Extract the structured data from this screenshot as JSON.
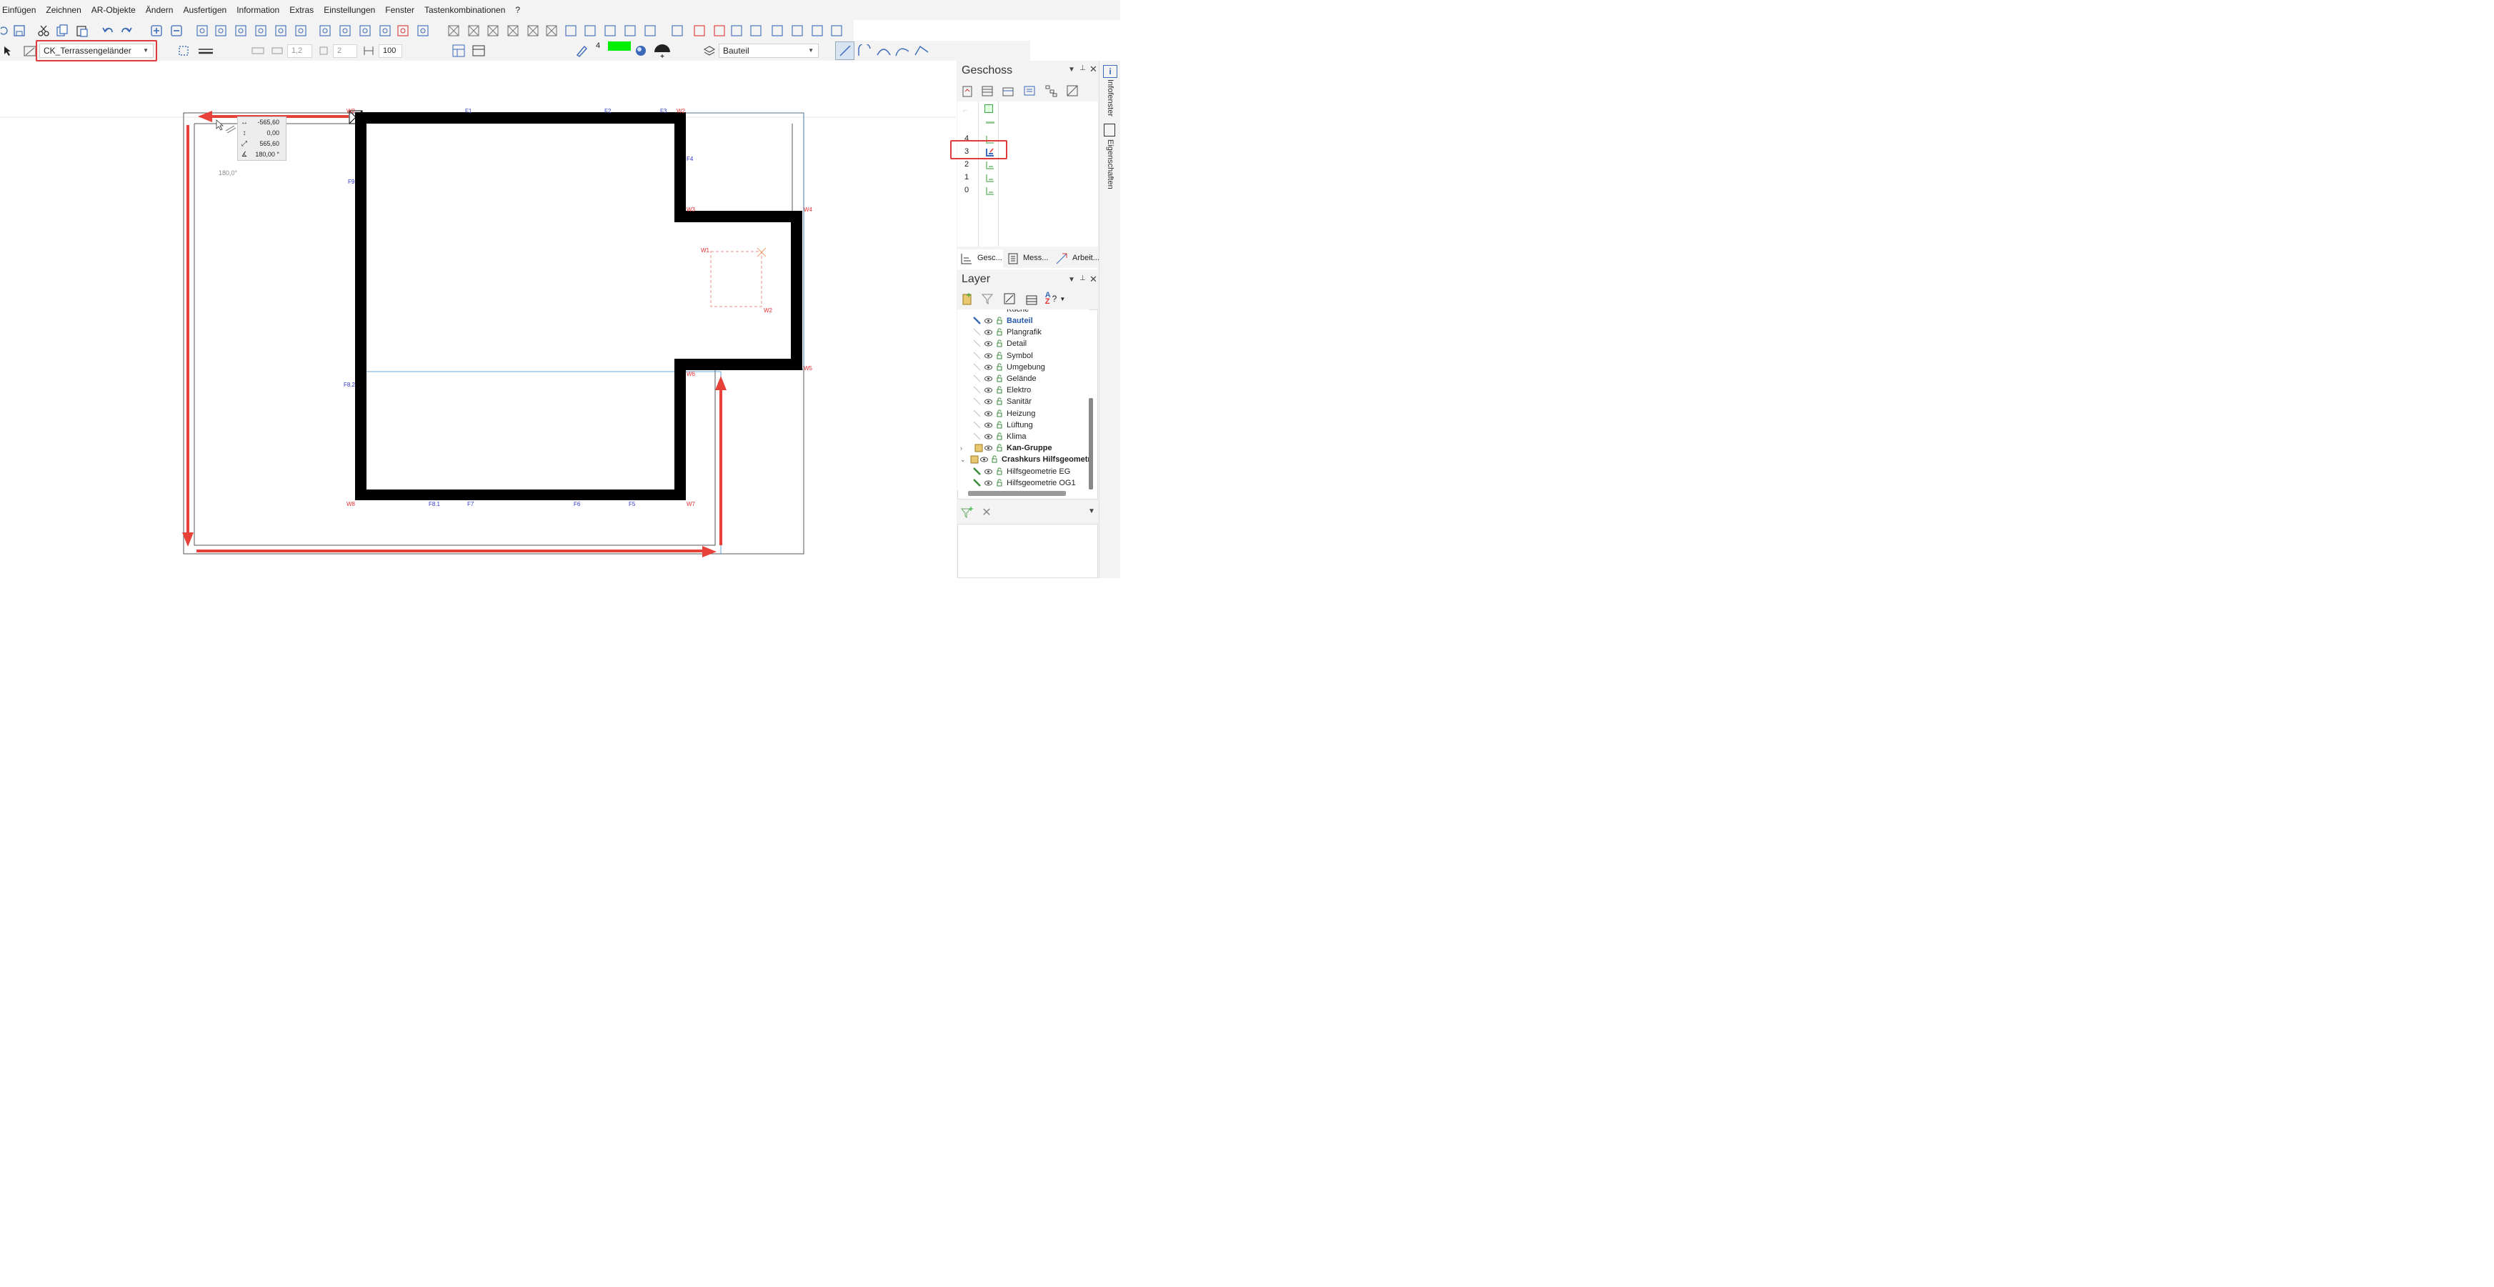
{
  "menu": [
    "Einfügen",
    "Zeichnen",
    "AR-Objekte",
    "Ändern",
    "Ausfertigen",
    "Information",
    "Extras",
    "Einstellungen",
    "Fenster",
    "Tastenkombinationen",
    "?"
  ],
  "toolbar2": {
    "object_type": "CK_Terrassengeländer",
    "field_1": "1,2",
    "field_2": "2",
    "field_3": "100",
    "pen_number": "4",
    "pen_color": "#00ee00",
    "layer_combo": "Bauteil"
  },
  "canvas": {
    "angle_tip": "180,0°",
    "coords": {
      "dx": "-565,60",
      "dy": "0,00",
      "length": "565,60",
      "angle": "180,00 °"
    },
    "point_labels": [
      {
        "text": "W2",
        "color": "red"
      },
      {
        "text": "F1",
        "color": "blue"
      },
      {
        "text": "F2",
        "color": "blue"
      },
      {
        "text": "F3",
        "color": "blue"
      },
      {
        "text": "W2",
        "color": "red"
      },
      {
        "text": "F4",
        "color": "blue"
      },
      {
        "text": "F9",
        "color": "blue"
      },
      {
        "text": "W3",
        "color": "red"
      },
      {
        "text": "W4",
        "color": "red"
      },
      {
        "text": "W1",
        "color": "red"
      },
      {
        "text": "W2",
        "color": "red"
      },
      {
        "text": "W6",
        "color": "red"
      },
      {
        "text": "W5",
        "color": "red"
      },
      {
        "text": "F8.2",
        "color": "blue"
      },
      {
        "text": "W8",
        "color": "red"
      },
      {
        "text": "F8.1",
        "color": "blue"
      },
      {
        "text": "F7",
        "color": "blue"
      },
      {
        "text": "F6",
        "color": "blue"
      },
      {
        "text": "F5",
        "color": "blue"
      },
      {
        "text": "W7",
        "color": "red"
      }
    ],
    "wall_color": "#000000",
    "arrow_color": "#e8413a"
  },
  "geschoss": {
    "title": "Geschoss",
    "floors": [
      "4",
      "3",
      "2",
      "1",
      "0"
    ],
    "active_floor": "3",
    "tabs": [
      "Gesc...",
      "Mess...",
      "Arbeit..."
    ]
  },
  "layer": {
    "title": "Layer",
    "partial_top": "Küche",
    "items": [
      {
        "name": "Bauteil",
        "active": true,
        "bold": true
      },
      {
        "name": "Plangrafik"
      },
      {
        "name": "Detail"
      },
      {
        "name": "Symbol"
      },
      {
        "name": "Umgebung"
      },
      {
        "name": "Gelände"
      },
      {
        "name": "Elektro"
      },
      {
        "name": "Sanitär"
      },
      {
        "name": "Heizung"
      },
      {
        "name": "Lüftung"
      },
      {
        "name": "Klima"
      },
      {
        "name": "Kan-Gruppe",
        "group": true,
        "bold": true
      },
      {
        "name": "Crashkurs Hilfsgeometr",
        "group": true,
        "bold": true,
        "expanded": true
      },
      {
        "name": "Hilfsgeometrie EG"
      },
      {
        "name": "Hilfsgeometrie OG1"
      }
    ]
  },
  "side_tabs": [
    "Infofenster",
    "Eigenschaften"
  ]
}
